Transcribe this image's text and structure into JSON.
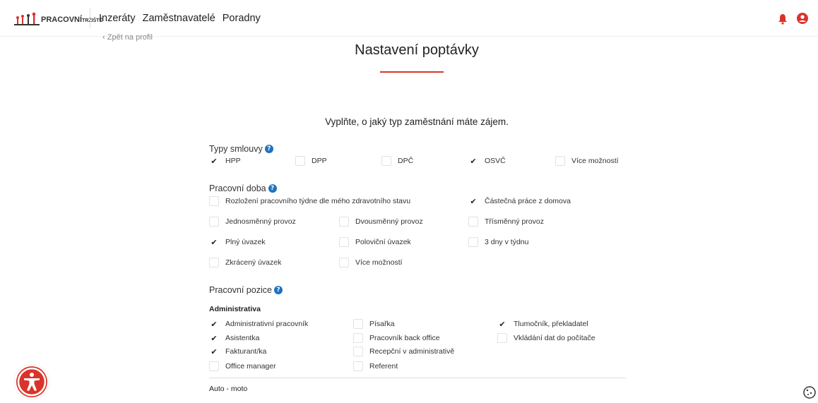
{
  "nav": {
    "logo_main": "PRACOVNÍ",
    "logo_sub": "TRŽIŠTĚ",
    "links": [
      "Inzeráty",
      "Zaměstnavatelé",
      "Poradny"
    ]
  },
  "back_link": "Zpět na profil",
  "page_title": "Nastavení poptávky",
  "intro": "Vyplňte, o jaký typ zaměstnání máte zájem.",
  "contract": {
    "title": "Typy smlouvy",
    "options": [
      {
        "label": "HPP",
        "checked": true
      },
      {
        "label": "DPP",
        "checked": false
      },
      {
        "label": "DPČ",
        "checked": false
      },
      {
        "label": "OSVČ",
        "checked": true
      },
      {
        "label": "Více možností",
        "checked": false
      }
    ]
  },
  "worktime": {
    "title": "Pracovní doba",
    "options": [
      {
        "label": "Rozložení pracovního týdne dle mého zdravotního stavu",
        "checked": false
      },
      {
        "label": "Částečná práce z domova",
        "checked": true
      },
      {
        "label": "Jednosměnný provoz",
        "checked": false
      },
      {
        "label": "Dvousměnný provoz",
        "checked": false
      },
      {
        "label": "Třísměnný provoz",
        "checked": false
      },
      {
        "label": "Plný úvazek",
        "checked": true
      },
      {
        "label": "Poloviční úvazek",
        "checked": false
      },
      {
        "label": "3 dny v týdnu",
        "checked": false
      },
      {
        "label": "Zkrácený úvazek",
        "checked": false
      },
      {
        "label": "Více možností",
        "checked": false
      }
    ]
  },
  "positions": {
    "title": "Pracovní pozice",
    "category": "Administrativa",
    "options": [
      {
        "label": "Administrativní pracovník",
        "checked": true
      },
      {
        "label": "Písařka",
        "checked": false
      },
      {
        "label": "Tlumočník, překladatel",
        "checked": true
      },
      {
        "label": "Asistentka",
        "checked": true
      },
      {
        "label": "Pracovník back office",
        "checked": false
      },
      {
        "label": "Vkládání dat do počítače",
        "checked": false
      },
      {
        "label": "Fakturant/ka",
        "checked": true
      },
      {
        "label": "Recepční v administrativě",
        "checked": false
      },
      {
        "label": "Office manager",
        "checked": false
      },
      {
        "label": "Referent",
        "checked": false
      }
    ],
    "next_category": "Auto - moto"
  },
  "colors": {
    "accent": "#d9342b",
    "help": "#1e73be"
  }
}
